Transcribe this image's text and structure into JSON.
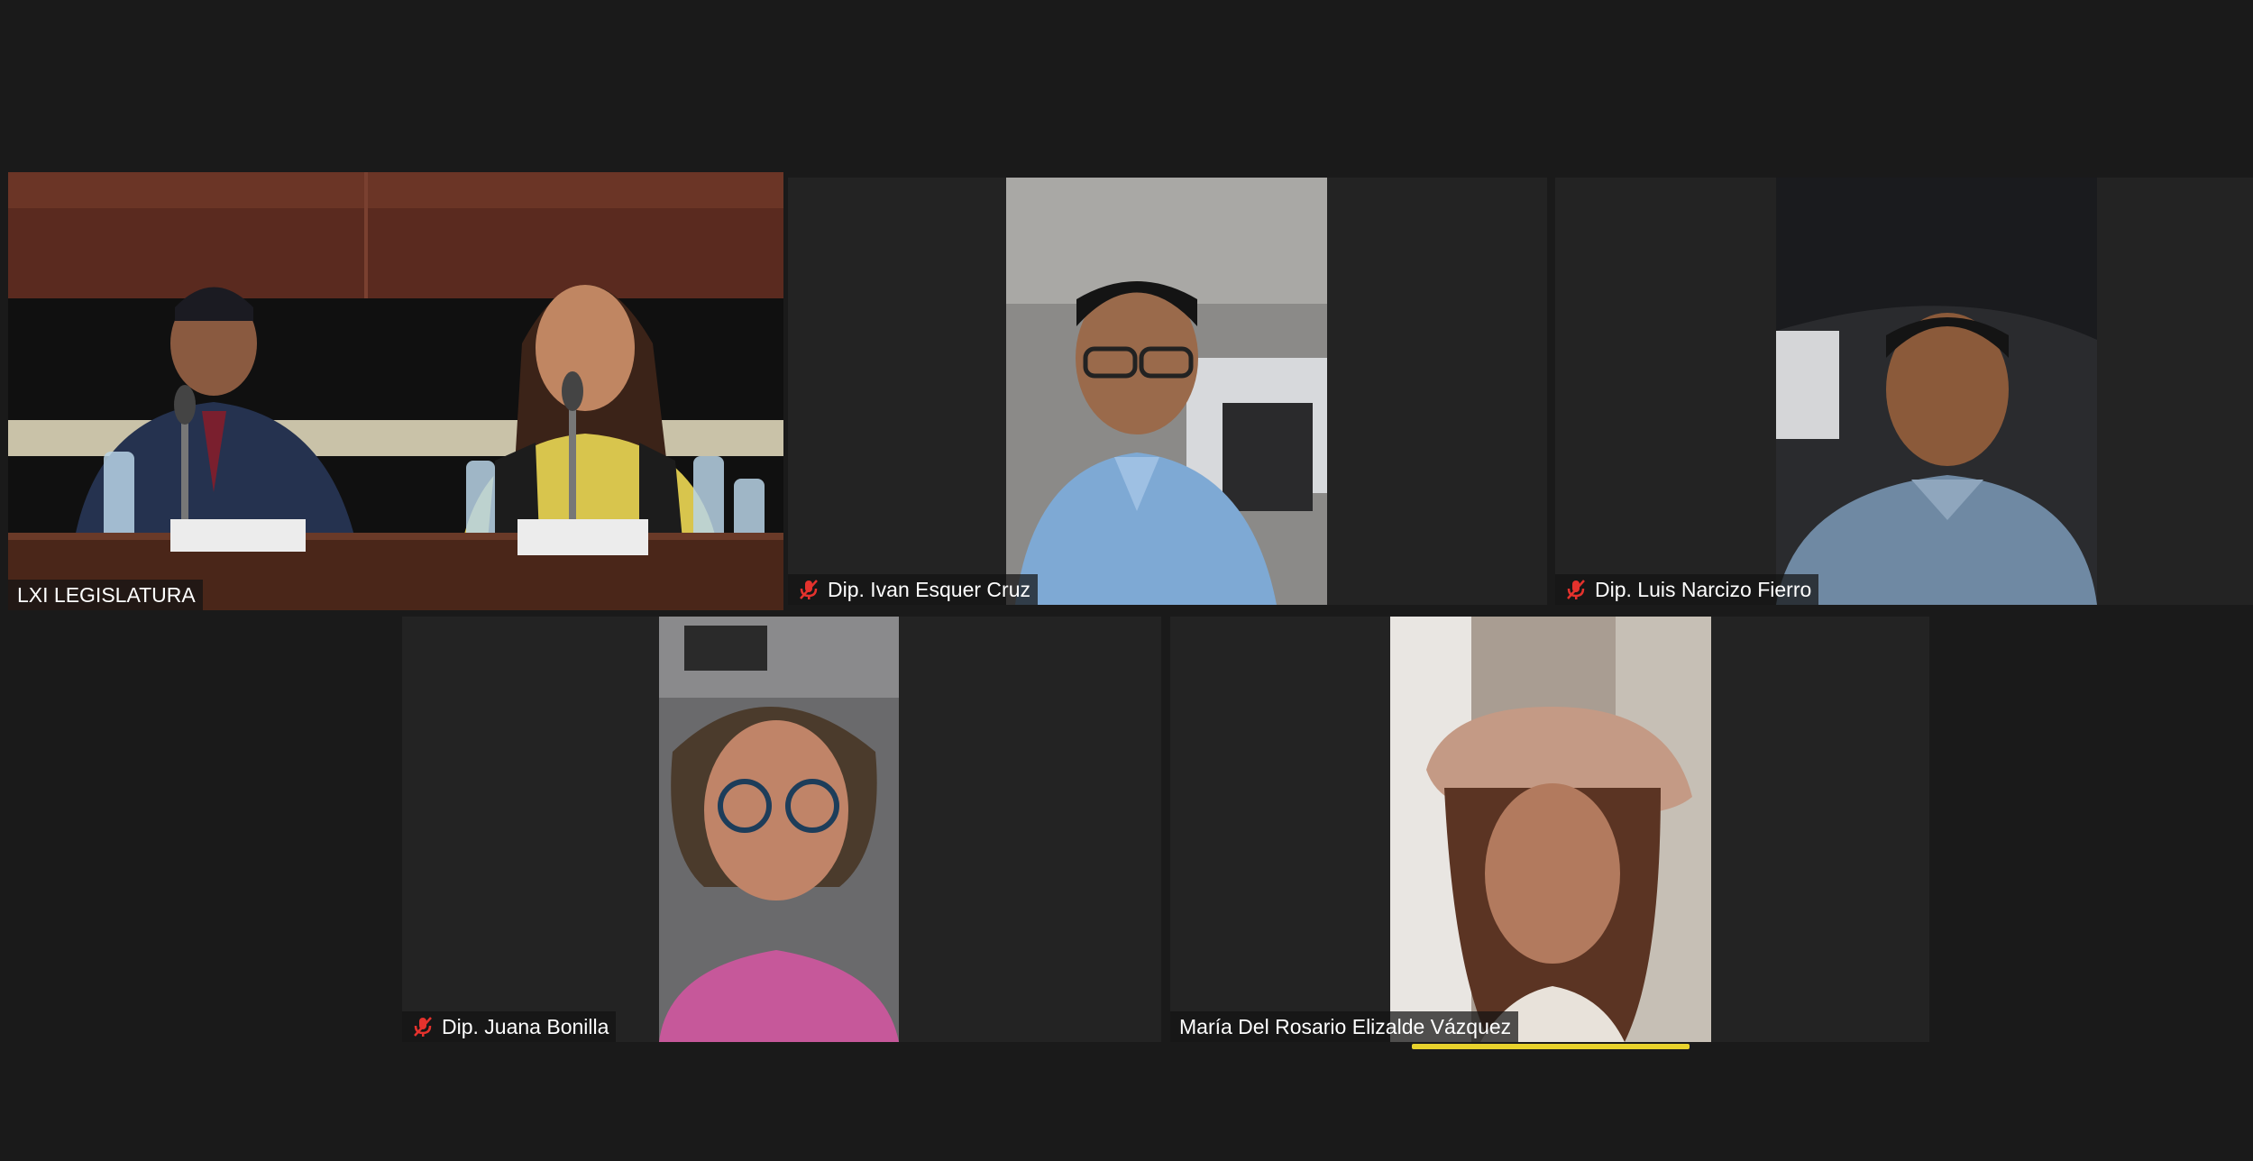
{
  "meeting": {
    "tiles": [
      {
        "name": "LXI LEGISLATURA",
        "muted": false
      },
      {
        "name": "Dip. Ivan Esquer Cruz",
        "muted": true
      },
      {
        "name": "Dip. Luis Narcizo Fierro",
        "muted": true
      },
      {
        "name": "Dip. Juana Bonilla",
        "muted": true
      },
      {
        "name": "María Del Rosario Elizalde Vázquez",
        "muted": false
      }
    ]
  },
  "colors": {
    "background": "#1a1a1a",
    "tile_background": "#232323",
    "active_border": "#c6d33a",
    "speaker_indicator": "#e8d22c",
    "mute_icon": "#e5322d"
  },
  "icons": {
    "mute": "microphone-muted-icon"
  }
}
